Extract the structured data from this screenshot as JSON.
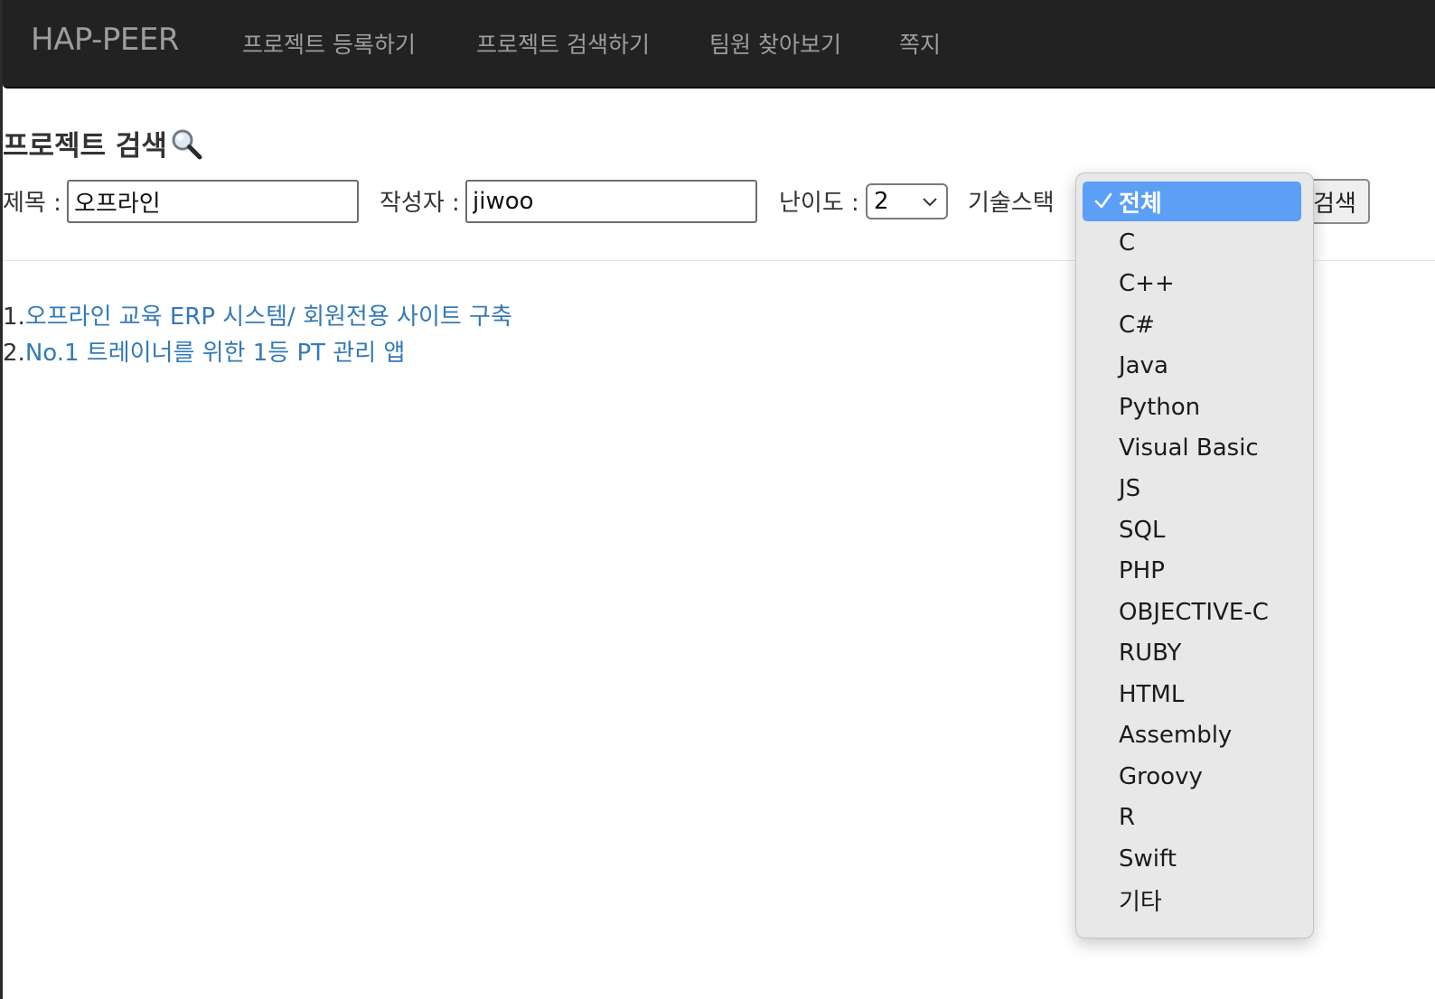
{
  "navbar": {
    "brand": "HAP-PEER",
    "links": [
      {
        "label": "프로젝트 등록하기"
      },
      {
        "label": "프로젝트 검색하기"
      },
      {
        "label": "팀원 찾아보기"
      },
      {
        "label": "쪽지"
      }
    ]
  },
  "search": {
    "title": "프로젝트 검색",
    "title_icon": "magnifier-icon",
    "title_label": "제목 :",
    "title_value": "오프라인",
    "author_label": "작성자 :",
    "author_value": "jiwoo",
    "difficulty_label": "난이도 :",
    "difficulty_value": "2",
    "tech_label": "기술스택",
    "submit_label": "검색"
  },
  "results": [
    {
      "num": "1.",
      "title": "오프라인 교육 ERP 시스템/ 회원전용 사이트 구축"
    },
    {
      "num": "2.",
      "title": "No.1 트레이너를 위한 1등 PT 관리 앱"
    }
  ],
  "tech_dropdown": {
    "selected": "전체",
    "options": [
      {
        "label": "전체"
      },
      {
        "label": "C"
      },
      {
        "label": "C++"
      },
      {
        "label": "C#"
      },
      {
        "label": "Java"
      },
      {
        "label": "Python"
      },
      {
        "label": "Visual Basic"
      },
      {
        "label": "JS"
      },
      {
        "label": "SQL"
      },
      {
        "label": "PHP"
      },
      {
        "label": "OBJECTIVE-C"
      },
      {
        "label": "RUBY"
      },
      {
        "label": "HTML"
      },
      {
        "label": "Assembly"
      },
      {
        "label": "Groovy"
      },
      {
        "label": "R"
      },
      {
        "label": "Swift"
      },
      {
        "label": "기타"
      }
    ]
  },
  "colors": {
    "navbar_bg": "#222222",
    "nav_text": "#9d9d9d",
    "link": "#337ab7",
    "selected_option": "#5c9ff7"
  }
}
